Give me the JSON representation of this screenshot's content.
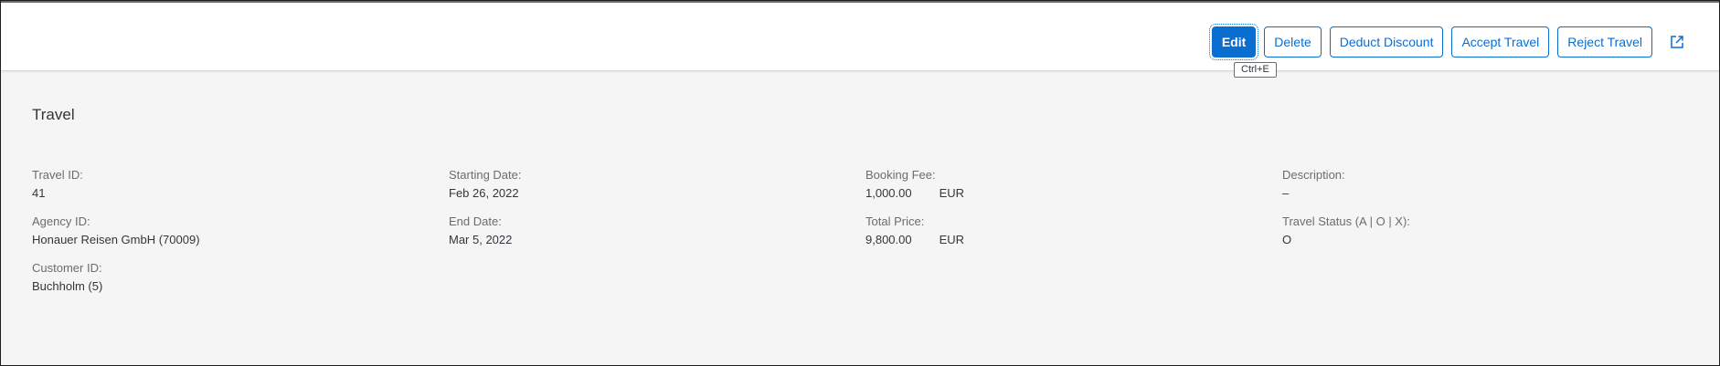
{
  "toolbar": {
    "edit_label": "Edit",
    "delete_label": "Delete",
    "deduct_discount_label": "Deduct Discount",
    "accept_travel_label": "Accept Travel",
    "reject_travel_label": "Reject Travel",
    "share_icon": "share-icon",
    "edit_tooltip": "Ctrl+E"
  },
  "section": {
    "title": "Travel"
  },
  "fields": {
    "travel_id": {
      "label": "Travel ID:",
      "value": "41"
    },
    "agency_id": {
      "label": "Agency ID:",
      "value": "Honauer Reisen GmbH (70009)"
    },
    "customer_id": {
      "label": "Customer ID:",
      "value": "Buchholm (5)"
    },
    "starting_date": {
      "label": "Starting Date:",
      "value": "Feb 26, 2022"
    },
    "end_date": {
      "label": "End Date:",
      "value": "Mar 5, 2022"
    },
    "booking_fee": {
      "label": "Booking Fee:",
      "value": "1,000.00",
      "currency": "EUR"
    },
    "total_price": {
      "label": "Total Price:",
      "value": "9,800.00",
      "currency": "EUR"
    },
    "description": {
      "label": "Description:",
      "value": "–"
    },
    "travel_status": {
      "label": "Travel Status (A | O | X):",
      "value": "O"
    }
  },
  "colors": {
    "accent": "#0a6ed1",
    "background": "#f5f5f5",
    "text": "#32363a",
    "label": "#6a6d70"
  }
}
